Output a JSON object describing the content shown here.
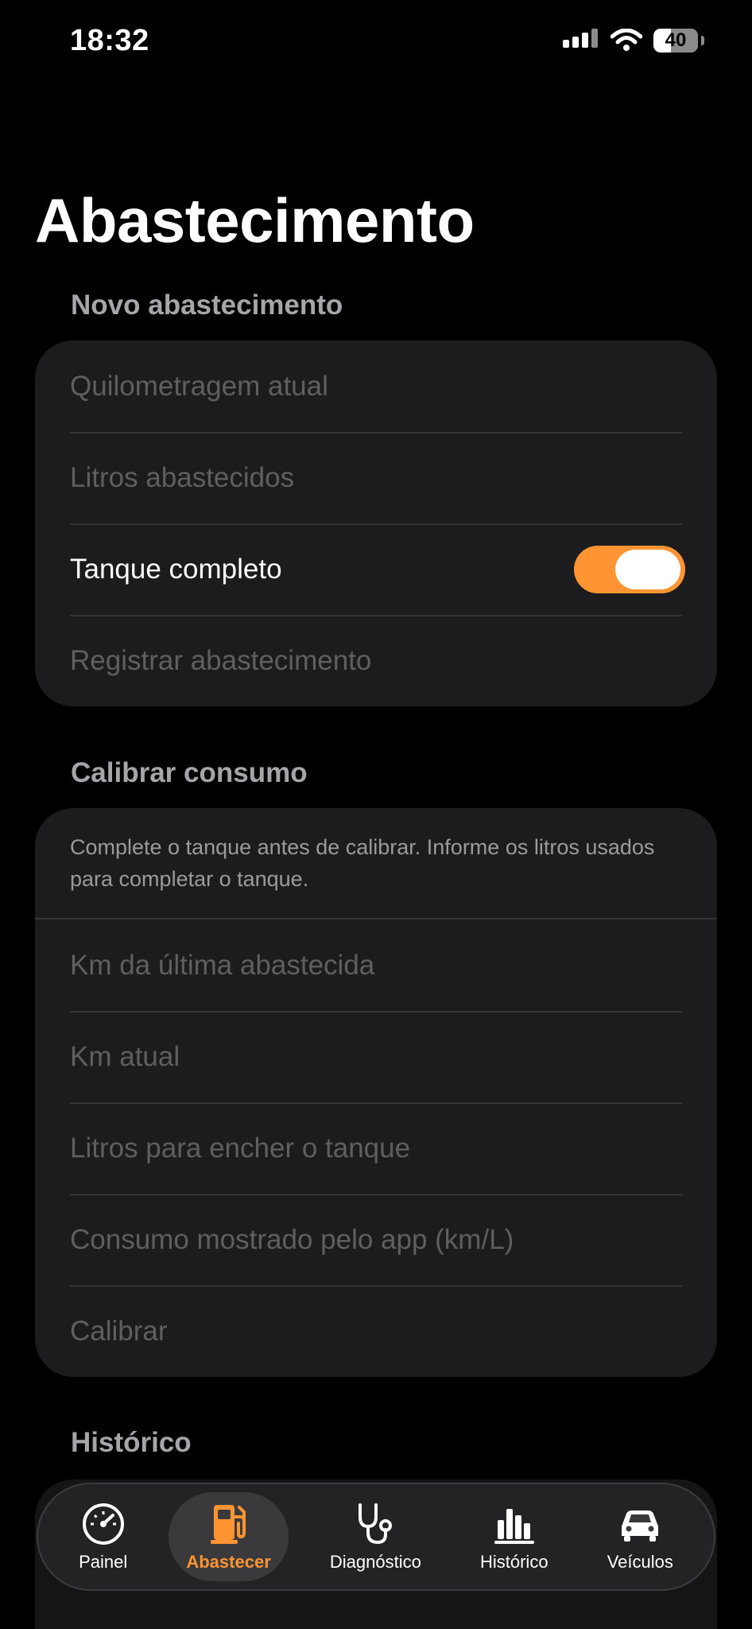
{
  "status_bar": {
    "time": "18:32",
    "battery": "40",
    "battery_level": 0.4
  },
  "page": {
    "title": "Abastecimento"
  },
  "refuel": {
    "header": "Novo abastecimento",
    "mileage_placeholder": "Quilometragem atual",
    "liters_placeholder": "Litros abastecidos",
    "full_tank_label": "Tanque completo",
    "full_tank_on": true,
    "register_button": "Registrar abastecimento"
  },
  "calibrate": {
    "header": "Calibrar consumo",
    "note": "Complete o tanque antes de calibrar. Informe os litros usados para completar o tanque.",
    "last_km_placeholder": "Km da última abastecida",
    "current_km_placeholder": "Km atual",
    "fill_liters_placeholder": "Litros para encher o tanque",
    "app_consumption_placeholder": "Consumo mostrado pelo app (km/L)",
    "calibrate_button": "Calibrar"
  },
  "history": {
    "header": "Histórico"
  },
  "tabs": [
    {
      "label": "Painel",
      "icon": "speedometer-icon",
      "active": false
    },
    {
      "label": "Abastecer",
      "icon": "fuel-pump-icon",
      "active": true
    },
    {
      "label": "Diagnóstico",
      "icon": "stethoscope-icon",
      "active": false
    },
    {
      "label": "Histórico",
      "icon": "bar-chart-icon",
      "active": false
    },
    {
      "label": "Veículos",
      "icon": "car-icon",
      "active": false
    }
  ],
  "colors": {
    "accent": "#ff9432",
    "card": "#1c1c1e",
    "background": "#000000"
  }
}
